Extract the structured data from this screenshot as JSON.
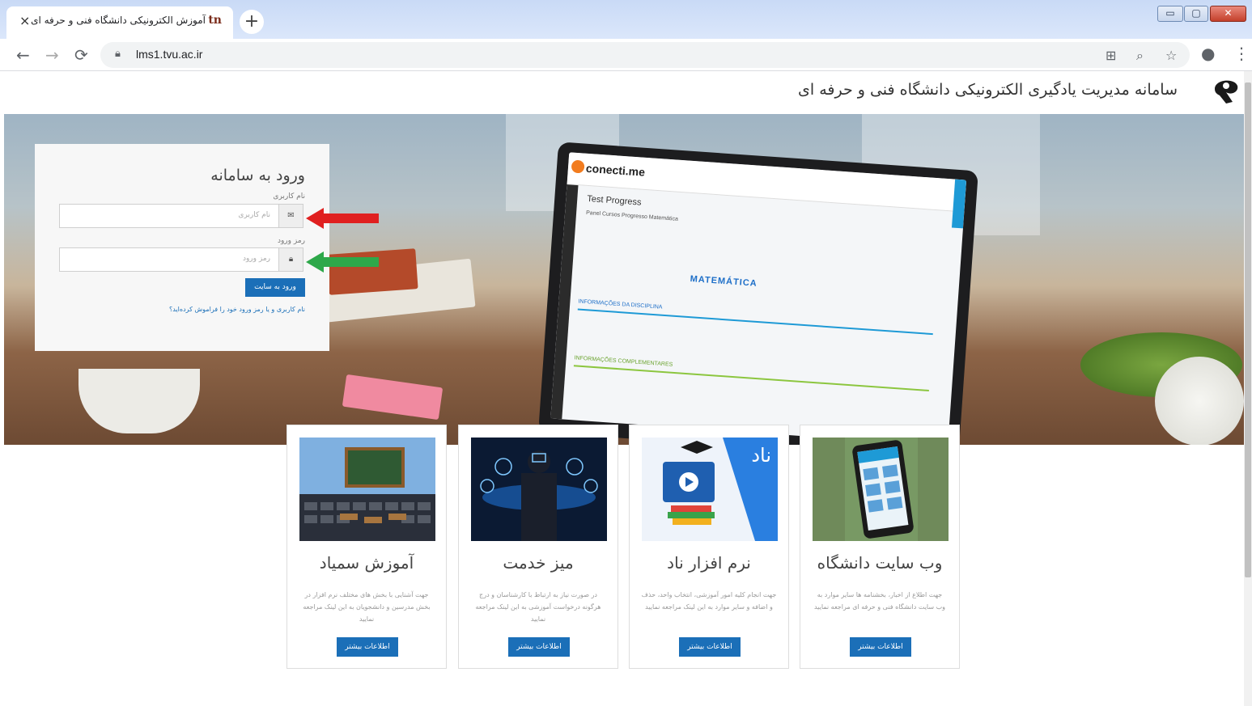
{
  "browser": {
    "tab_title": "آموزش الکترونیکی دانشگاه فنی و حرفه ای",
    "tab_close": "×",
    "new_tab": "+",
    "url": "lms1.tvu.ac.ir",
    "window_min": "▭",
    "window_max": "▢",
    "window_close": "✕"
  },
  "header": {
    "site_title": "سامانه مدیریت یادگیری الکترونیکی دانشگاه فنی و حرفه ای"
  },
  "login": {
    "title": "ورود به سامانه",
    "username_label": "نام کاربری",
    "username_placeholder": "نام کاربری",
    "password_label": "رمز ورود",
    "password_placeholder": "رمز ورود",
    "submit": "ورود به سایت",
    "forgot": "نام کاربری و یا رمز ورود خود را فراموش کرده‌اید؟"
  },
  "annotations": {
    "username_arrow_color": "#e02020",
    "password_arrow_color": "#2ea84a"
  },
  "hero_screen": {
    "brand": "conecti.me",
    "page_title": "Test Progress",
    "tabs": "Panel    Cursos    Progresso    Matemática",
    "subject": "MATEMÁTICA",
    "section1": "INFORMAÇÕES DA DISCIPLINA",
    "section2": "INFORMAÇÕES COMPLEMENTARES"
  },
  "cards": [
    {
      "title": "آموزش سمیاد",
      "description": "جهت آشنایی با بخش های مختلف نرم افزار در بخش مدرسین و دانشجویان به این لینک مراجعه نمایید",
      "button": "اطلاعات بیشتر"
    },
    {
      "title": "میز خدمت",
      "description": "در صورت نیاز به ارتباط با کارشناسان و درج هرگونه درخواست آموزشی به این لینک مراجعه نمایید",
      "button": "اطلاعات بیشتر"
    },
    {
      "title": "نرم افزار ناد",
      "description": "جهت انجام کلیه امور آموزشی، انتخاب واحد، حذف و اضافه و سایر موارد به این لینک مراجعه نمایید",
      "button": "اطلاعات بیشتر"
    },
    {
      "title": "وب سایت دانشگاه",
      "description": "جهت اطلاع از اخبار، بخشنامه ها سایر موارد به وب سایت دانشگاه فنی و حرفه ای مراجعه نمایید",
      "button": "اطلاعات بیشتر"
    }
  ],
  "card_images": [
    "classroom-keyboard",
    "digital-services-tablet",
    "nad-video-books",
    "smartphone-university-site"
  ],
  "nad_badge": "ناد"
}
